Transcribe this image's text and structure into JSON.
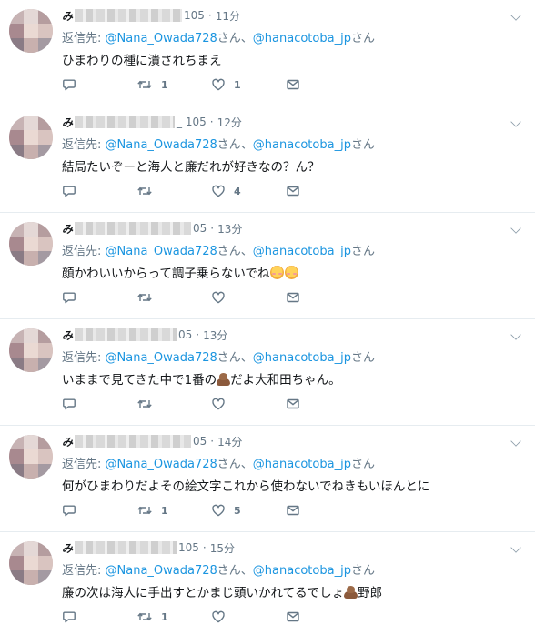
{
  "tweets": [
    {
      "name": "み",
      "handle_suffix": "105",
      "time": "11分",
      "reply_prefix": "返信先: ",
      "mention1": "@Nana_Owada728",
      "san1": "さん、",
      "mention2": "@hanacotoba_jp",
      "san2": "さん",
      "text": "ひまわりの種に潰されちまえ",
      "emoji": "",
      "text_after": "",
      "retweets": "1",
      "likes": "1"
    },
    {
      "name": "み",
      "handle_suffix": "_ 105",
      "time": "12分",
      "reply_prefix": "返信先: ",
      "mention1": "@Nana_Owada728",
      "san1": "さん、",
      "mention2": "@hanacotoba_jp",
      "san2": "さん",
      "text": "結局たいぞーと海人と廉だれが好きなの？ん？",
      "emoji": "",
      "text_after": "",
      "retweets": "",
      "likes": "4"
    },
    {
      "name": "み",
      "handle_suffix": "05",
      "time": "13分",
      "reply_prefix": "返信先: ",
      "mention1": "@Nana_Owada728",
      "san1": "さん、",
      "mention2": "@hanacotoba_jp",
      "san2": "さん",
      "text": "顔かわいいからって調子乗らないでね",
      "emoji": "blush2",
      "text_after": "",
      "retweets": "",
      "likes": ""
    },
    {
      "name": "み",
      "handle_suffix": "05",
      "time": "13分",
      "reply_prefix": "返信先: ",
      "mention1": "@Nana_Owada728",
      "san1": "さん、",
      "mention2": "@hanacotoba_jp",
      "san2": "さん",
      "text": "いままで見てきた中で1番の",
      "emoji": "poo",
      "text_after": "だよ大和田ちゃん。",
      "retweets": "",
      "likes": ""
    },
    {
      "name": "み",
      "handle_suffix": "05",
      "time": "14分",
      "reply_prefix": "返信先: ",
      "mention1": "@Nana_Owada728",
      "san1": "さん、",
      "mention2": "@hanacotoba_jp",
      "san2": "さん",
      "text": "何がひまわりだよその絵文字これから使わないでねきもいほんとに",
      "emoji": "",
      "text_after": "",
      "retweets": "1",
      "likes": "5"
    },
    {
      "name": "み",
      "handle_suffix": "105",
      "time": "15分",
      "reply_prefix": "返信先: ",
      "mention1": "@Nana_Owada728",
      "san1": "さん、",
      "mention2": "@hanacotoba_jp",
      "san2": "さん",
      "text": "廉の次は海人に手出すとかまじ頭いかれてるでしょ",
      "emoji": "poo",
      "text_after": "野郎",
      "retweets": "1",
      "likes": ""
    }
  ]
}
